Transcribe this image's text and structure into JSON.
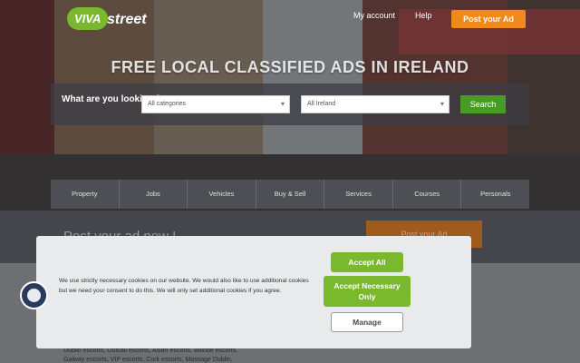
{
  "header": {
    "logo_part1": "VIVA",
    "logo_part2": "street",
    "nav": {
      "account": "My account",
      "help": "Help",
      "post": "Post your Ad"
    }
  },
  "hero": {
    "headline": "FREE LOCAL CLASSIFIED ADS IN IRELAND",
    "search_question": "What are you looking for ?",
    "category_select": "All categories",
    "location_select": "All Ireland",
    "search_button": "Search"
  },
  "categories": [
    "Property",
    "Jobs",
    "Vehicles",
    "Buy & Sell",
    "Services",
    "Courses",
    "Personals"
  ],
  "band": {
    "post_now": "Post your ad now !",
    "post_button": "Post your Ad"
  },
  "footer_text": {
    "line1": "Dublin escorts, Outcall escorts, Asian escorts, Blonde escorts,",
    "line2": "Galway escorts, VIP escorts, Cork escorts, Massage Dublin,"
  },
  "cookie": {
    "message": "We use strictly necessary cookies on our website. We would also like to use additional cookies but we need your consent to do this. We will only set additional cookies if you agree.",
    "accept_all": "Accept All",
    "accept_necessary": "Accept Necessary Only",
    "manage": "Manage"
  },
  "colors": {
    "brand_green": "#7ab82e",
    "post_orange": "#f08a1c"
  }
}
